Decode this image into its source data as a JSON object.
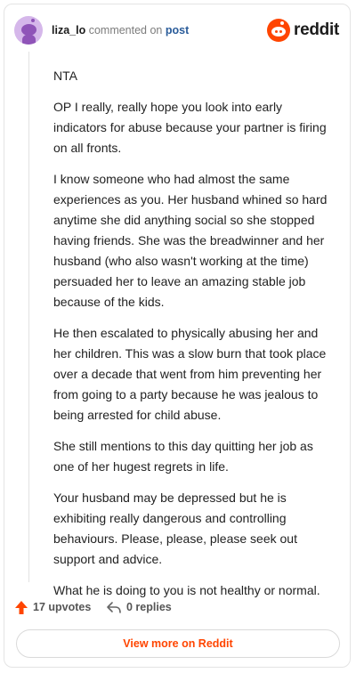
{
  "comment": {
    "username": "liza_lo",
    "commented_on_text": "commented on",
    "post_link_label": "post",
    "paragraphs": [
      "NTA",
      "OP I really, really hope you look into early indicators for abuse because your partner is firing on all fronts.",
      "I know someone who had almost the same experiences as you. Her husband whined so hard anytime she did anything social so she stopped having friends. She was the breadwinner and her husband (who also wasn't working at the time) persuaded her to leave an amazing stable job because of the kids.",
      "He then escalated to physically abusing her and her children. This was a slow burn that took place over a decade that went from him preventing her from going to a party because he was jealous to being arrested for child abuse.",
      "She still mentions to this day quitting her job as one of her hugest regrets in life.",
      "Your husband may be depressed but he is exhibiting really dangerous and controlling behaviours. Please, please, please seek out support and advice.",
      "What he is doing to you is not healthy or normal."
    ]
  },
  "brand": {
    "wordmark": "reddit",
    "logo_icon": "reddit-logo-icon"
  },
  "actions": {
    "upvotes_label": "17 upvotes",
    "replies_label": "0 replies"
  },
  "footer": {
    "view_more_label": "View more on Reddit"
  },
  "colors": {
    "accent": "#ff4500",
    "link": "#2a5c9a",
    "avatar_bg": "#d5b7ea",
    "avatar_fg": "#8f54b8"
  }
}
